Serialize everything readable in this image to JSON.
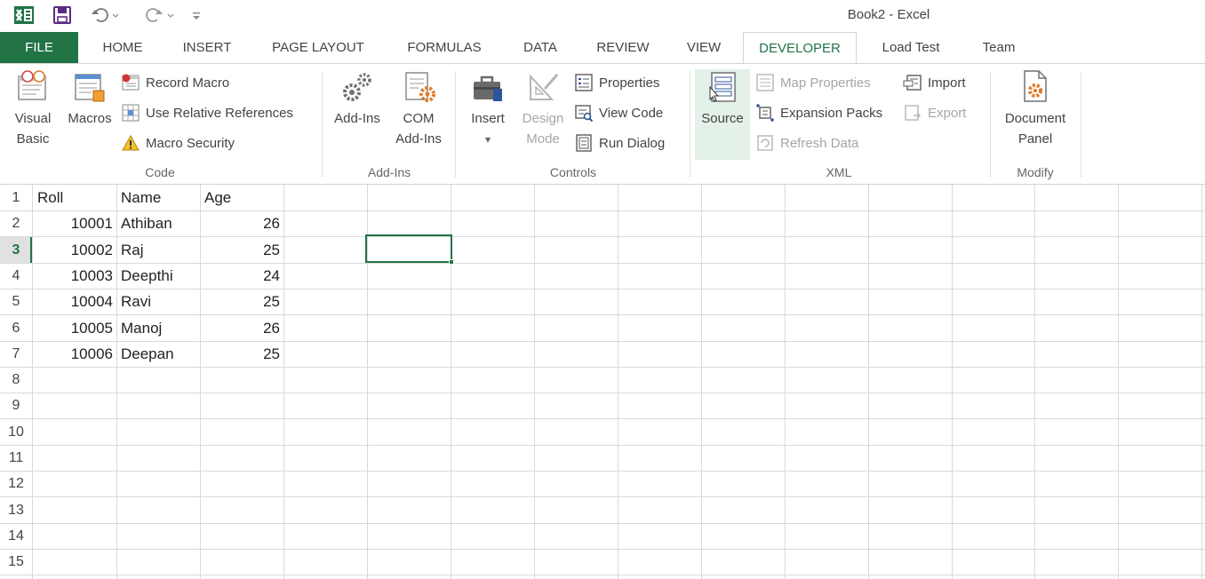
{
  "window": {
    "title": "Book2 - Excel"
  },
  "quick_access": {
    "app_icon": "excel-logo-icon",
    "save_icon": "save-icon",
    "undo_icon": "undo-icon",
    "redo_icon": "redo-icon",
    "customize_icon": "customize-qat-icon"
  },
  "tabs": [
    "FILE",
    "HOME",
    "INSERT",
    "PAGE LAYOUT",
    "FORMULAS",
    "DATA",
    "REVIEW",
    "VIEW",
    "DEVELOPER",
    "Load Test",
    "Team"
  ],
  "active_tab": "DEVELOPER",
  "ribbon": {
    "code": {
      "label": "Code",
      "visual_basic": [
        "Visual",
        "Basic"
      ],
      "macros": "Macros",
      "record_macro": "Record Macro",
      "use_relative": "Use Relative References",
      "macro_security": "Macro Security"
    },
    "addins": {
      "label": "Add-Ins",
      "addins": "Add-Ins",
      "com_addins": [
        "COM",
        "Add-Ins"
      ]
    },
    "controls": {
      "label": "Controls",
      "insert": "Insert",
      "insert_arrow": "▾",
      "design_mode": [
        "Design",
        "Mode"
      ],
      "properties": "Properties",
      "view_code": "View Code",
      "run_dialog": "Run Dialog"
    },
    "xml": {
      "label": "XML",
      "source": "Source",
      "map_properties": "Map Properties",
      "expansion_packs": "Expansion Packs",
      "refresh_data": "Refresh Data",
      "import": "Import",
      "export": "Export"
    },
    "modify": {
      "label": "Modify",
      "document_panel": [
        "Document",
        "Panel"
      ]
    }
  },
  "sheet": {
    "row_numbers": [
      "1",
      "2",
      "3",
      "4",
      "5",
      "6",
      "7",
      "8",
      "9",
      "10",
      "11",
      "12",
      "13",
      "14",
      "15"
    ],
    "headers": [
      "Roll",
      "Name",
      "Age"
    ],
    "rows": [
      [
        "10001",
        "Athiban",
        "26"
      ],
      [
        "10002",
        "Raj",
        "25"
      ],
      [
        "10003",
        "Deepthi",
        "24"
      ],
      [
        "10004",
        "Ravi",
        "25"
      ],
      [
        "10005",
        "Manoj",
        "26"
      ],
      [
        "10006",
        "Deepan",
        "25"
      ]
    ]
  },
  "colors": {
    "accent": "#217346",
    "grid": "#d9d9d9",
    "disabled": "#a6a6a6",
    "source_hover": "#e3f1e8"
  }
}
